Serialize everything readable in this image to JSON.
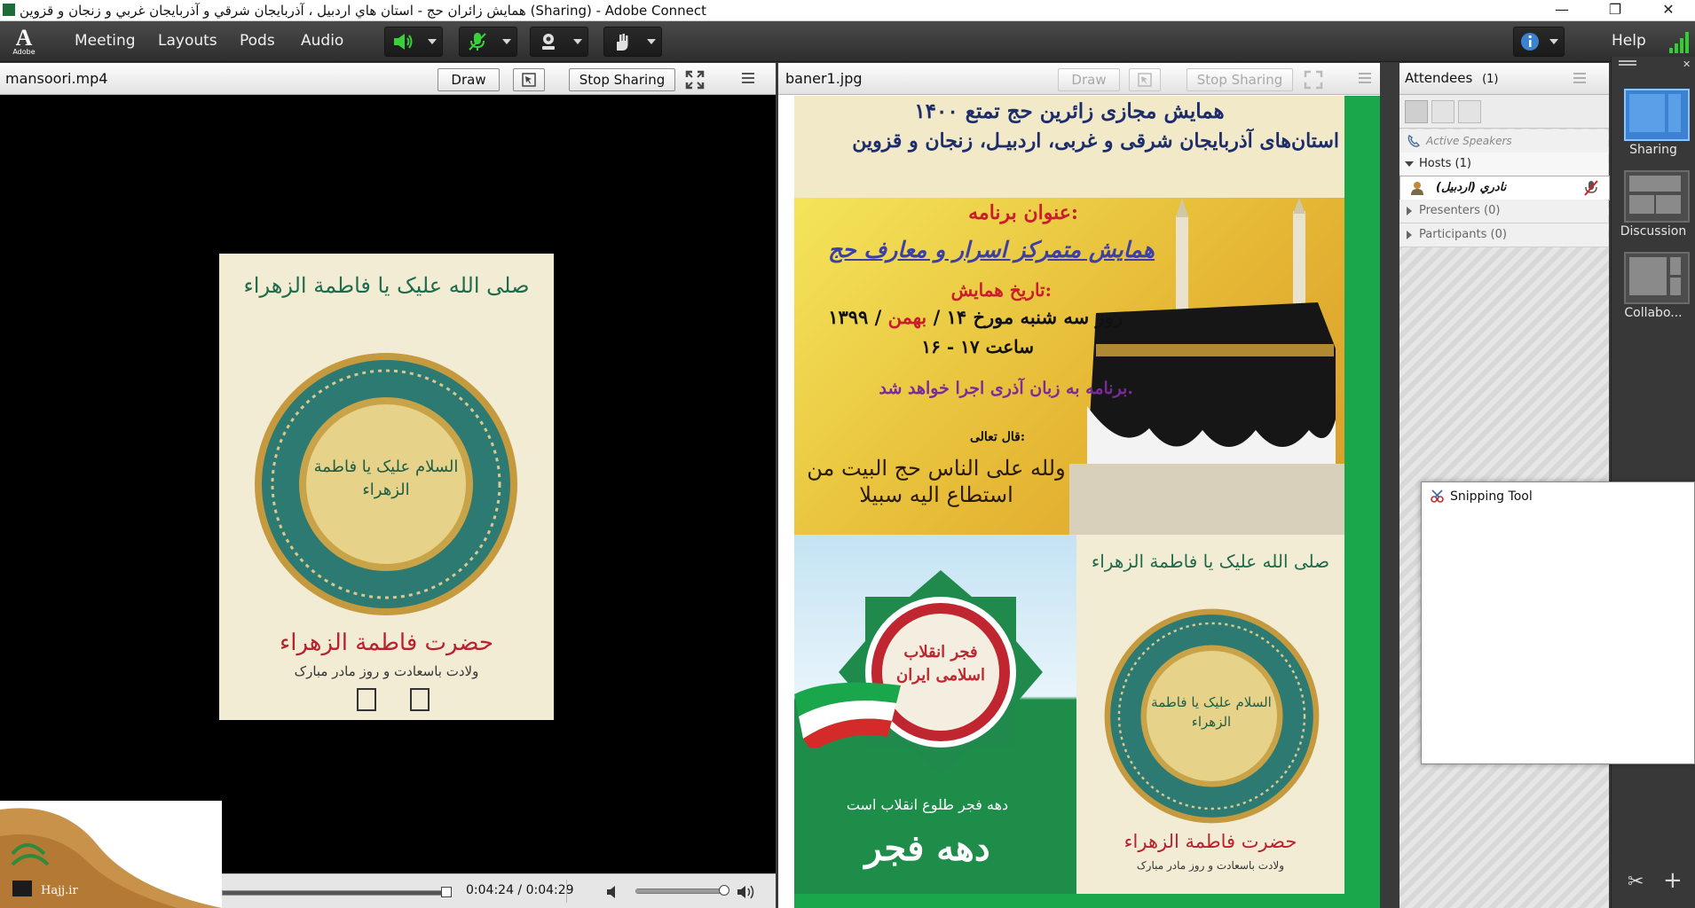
{
  "window": {
    "title": "همایش زائران حج - استان هاي اردبيل ، آذربايجان شرقي و آذربايجان غربي و زنجان و قزوين (Sharing) - Adobe Connect",
    "controls": {
      "minimize": "—",
      "restore": "❐",
      "close": "✕"
    }
  },
  "menu": {
    "logo_label": "Adobe",
    "items": [
      "Meeting",
      "Layouts",
      "Pods",
      "Audio"
    ],
    "help": "Help"
  },
  "video_pod": {
    "title": "mansoori.mp4",
    "draw": "Draw",
    "stop_sharing": "Stop Sharing",
    "time": "0:04:24 / 0:04:29",
    "progress": 0.981,
    "volume": 1.0,
    "poster": {
      "top_calligraphy": "صلی الله علیک یا فاطمة الزهراء",
      "center_calligraphy": "السلام علیک یا فاطمة الزهراء",
      "line1": "حضرت فاطمة الزهراء",
      "line2": "ولادت باسعادت و روز مادر مبارک"
    },
    "watermark": "Hajj.ir"
  },
  "image_pod": {
    "title": "baner1.jpg",
    "draw": "Draw",
    "stop_sharing": "Stop Sharing",
    "banner": {
      "headline1": "همایش مجازی زائرین حج تمتع ۱۴۰۰",
      "headline2": "استان‌های آذربایجان شرقی و غربی، اردبیـل، زنجان و قزوین",
      "program_label": "عنوان برنامه:",
      "program_title": "همایش متمرکز اسرار و معارف حج",
      "date_label": "تاریخ همایش:",
      "date_prefix": "روز سه شنبه مورخ ۱۴ /",
      "date_month": "بهمن",
      "date_year": "/ ۱۳۹۹",
      "time": "ساعت ۱۷ - ۱۶",
      "language_note": "برنامه به زبان آذری اجرا خواهد شد.",
      "quote_intro": "قال تعالی:",
      "quote": "ولله علی الناس حج البیت من استطاع الیه سبیلا",
      "fajr_top": "فجر انقلاب اسلامی ایران",
      "fajr_sub": "دهه فجر طلوع انقلاب است",
      "fajr_big": "دهه فجر",
      "zahra_top": "صلی الله علیک یا فاطمة الزهراء",
      "zahra_center": "السلام علیک یا فاطمة الزهراء",
      "zahra_line1": "حضرت فاطمة الزهراء",
      "zahra_line2": "ولادت باسعادت و روز مادر مبارک"
    }
  },
  "attendees": {
    "title": "Attendees",
    "count": "(1)",
    "active_speakers": "Active Speakers",
    "hosts": "Hosts (1)",
    "host_name": "نادري (اردبيل)",
    "presenters": "Presenters (0)",
    "participants": "Participants (0)"
  },
  "layouts": [
    {
      "label": "Sharing"
    },
    {
      "label": "Discussion"
    },
    {
      "label": "Collabo..."
    }
  ],
  "snipping_tool": {
    "title": "Snipping Tool"
  },
  "colors": {
    "accent_blue": "#3b82d0",
    "green": "#1aa64a",
    "toolbar_dark": "#2e2e2e"
  }
}
